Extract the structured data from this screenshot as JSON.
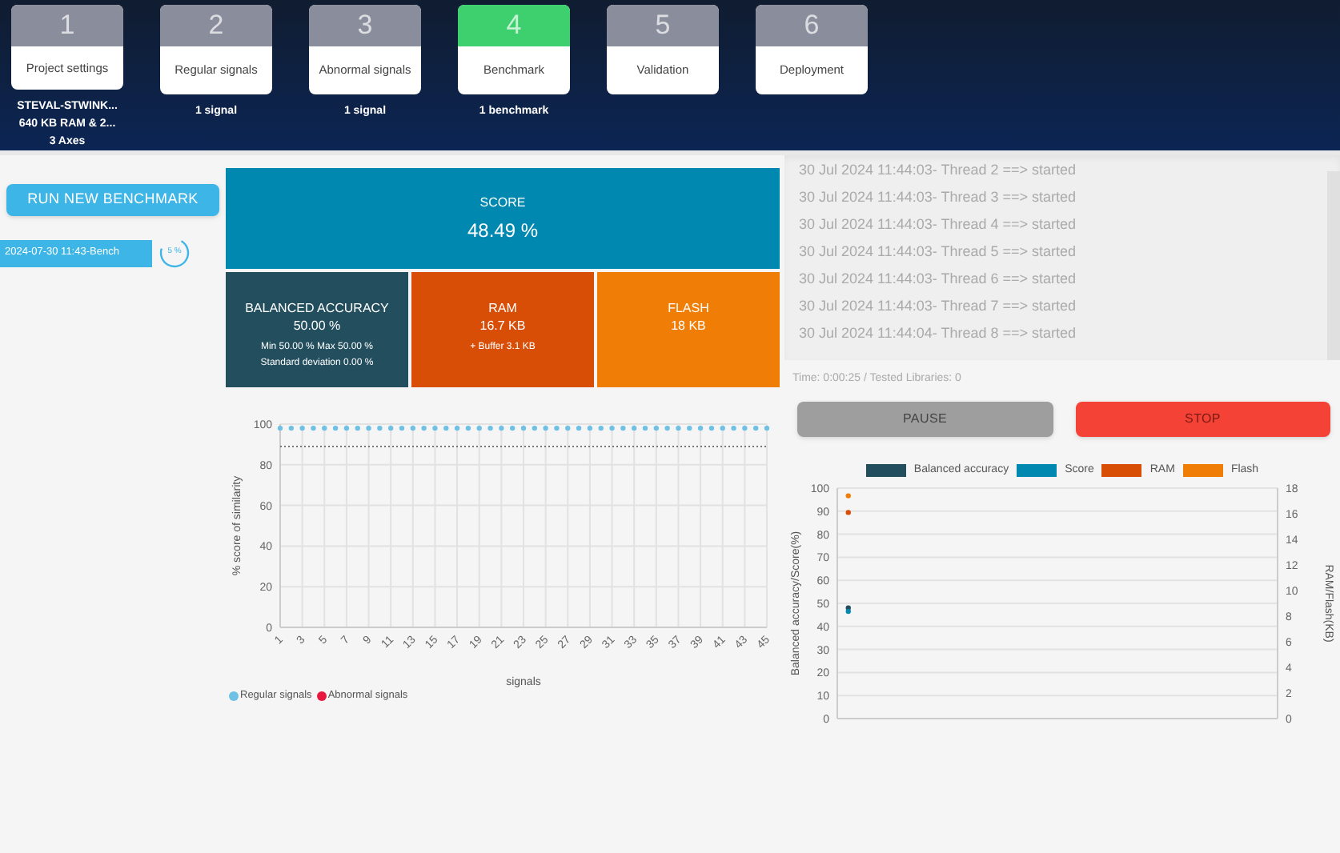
{
  "steps": [
    {
      "number": "1",
      "label": "Project settings",
      "selected": false,
      "captions": [
        "STEVAL-STWINK...",
        "640 KB RAM & 2...",
        "3 Axes"
      ]
    },
    {
      "number": "2",
      "label": "Regular signals",
      "selected": false,
      "captions": [
        "1 signal"
      ]
    },
    {
      "number": "3",
      "label": "Abnormal signals",
      "selected": false,
      "captions": [
        "1 signal"
      ]
    },
    {
      "number": "4",
      "label": "Benchmark",
      "selected": true,
      "captions": [
        "1 benchmark"
      ]
    },
    {
      "number": "5",
      "label": "Validation",
      "selected": false
    },
    {
      "number": "6",
      "label": "Deployment",
      "selected": false
    }
  ],
  "sidebar": {
    "run_button": "RUN NEW BENCHMARK",
    "benchmarks": [
      {
        "name": "2024-07-30 11:43-Bench",
        "progress": "5 %",
        "selected": true
      }
    ]
  },
  "score": {
    "title": "SCORE",
    "value": "48.49 %"
  },
  "metrics": [
    {
      "title": "BALANCED ACCURACY",
      "value": "50.00 %",
      "details": [
        "Min 50.00 % Max 50.00 %",
        "Standard deviation 0.00 %"
      ],
      "color": "#234e5e"
    },
    {
      "title": "RAM",
      "value": "16.7 KB",
      "details": [
        "+ Buffer 3.1 KB"
      ],
      "color": "#d94e06"
    },
    {
      "title": "FLASH",
      "value": "18 KB",
      "color": "#f07e06"
    }
  ],
  "log": {
    "lines": [
      "30 Jul 2024 11:44:03- Thread 2 ==> started",
      "30 Jul 2024 11:44:03- Thread 3 ==> started",
      "30 Jul 2024 11:44:03- Thread 4 ==> started",
      "30 Jul 2024 11:44:03- Thread 5 ==> started",
      "30 Jul 2024 11:44:03- Thread 6 ==> started",
      "30 Jul 2024 11:44:03- Thread 7 ==> started",
      "30 Jul 2024 11:44:04- Thread 8 ==> started"
    ],
    "status": "Time: 0:00:25 / Tested Libraries: 0"
  },
  "buttons": [
    {
      "kind": "pause",
      "label": "PAUSE"
    },
    {
      "kind": "stop",
      "label": "STOP"
    }
  ],
  "similarity_chart": {
    "chart_data": {
      "type": "scatter",
      "xlabel": "signals",
      "ylabel": "% score of similarity",
      "grid": true,
      "x": [
        1,
        2,
        3,
        4,
        5,
        6,
        7,
        8,
        9,
        10,
        11,
        12,
        13,
        14,
        15,
        16,
        17,
        18,
        19,
        20,
        21,
        22,
        23,
        24,
        25,
        26,
        27,
        28,
        29,
        30,
        31,
        32,
        33,
        34,
        35,
        36,
        37,
        38,
        39,
        40,
        41,
        42,
        43,
        44,
        45
      ],
      "xlim": [
        1,
        45
      ],
      "ylim": [
        0,
        100
      ],
      "xticks": [
        1,
        3,
        5,
        7,
        9,
        11,
        13,
        15,
        17,
        19,
        21,
        23,
        25,
        27,
        29,
        31,
        33,
        35,
        37,
        39,
        41,
        43,
        45
      ],
      "yticks": [
        0,
        20,
        40,
        60,
        80,
        100
      ],
      "series": [
        {
          "name": "Regular signals",
          "color": "#6ec1e4",
          "values": [
            98,
            98,
            98,
            98,
            98,
            98,
            98,
            98,
            98,
            98,
            98,
            98,
            98,
            98,
            98,
            98,
            98,
            98,
            98,
            98,
            98,
            98,
            98,
            98,
            98,
            98,
            98,
            98,
            98,
            98,
            98,
            98,
            98,
            98,
            98,
            98,
            98,
            98,
            98,
            98,
            98,
            98,
            98,
            98,
            98
          ]
        },
        {
          "name": "Abnormal signals",
          "color": "#e8173f",
          "values": [
            null,
            null,
            null,
            null,
            null,
            null,
            null,
            null,
            null,
            null,
            null,
            null,
            null,
            null,
            null,
            null,
            null,
            null,
            null,
            null,
            null,
            null,
            null,
            null,
            null,
            null,
            null,
            null,
            null,
            null,
            null,
            null,
            null,
            null,
            null,
            null,
            null,
            null,
            null,
            null,
            null,
            null,
            null,
            null,
            null
          ]
        }
      ],
      "ref_lines": [
        {
          "axis": "y",
          "value": 89
        }
      ]
    }
  },
  "history_chart": {
    "accuracy_axis": {
      "chart_data": {
        "type": "scatter",
        "ylabel": "Balanced accuracy/Score(%)",
        "grid": true,
        "categories": [
          null,
          null,
          null,
          null,
          null,
          null,
          null,
          null,
          null,
          null,
          null,
          null,
          null,
          null,
          null,
          null,
          null,
          null,
          null,
          null
        ],
        "ylim": [
          0,
          100
        ],
        "yticks": [
          0,
          10,
          20,
          30,
          40,
          50,
          60,
          70,
          80,
          90,
          100
        ],
        "series": [
          {
            "name": "Balanced accuracy",
            "color": "#234e5e",
            "values": [
              48,
              null,
              null,
              null,
              null,
              null,
              null,
              null,
              null,
              null,
              null,
              null,
              null,
              null,
              null,
              null,
              null,
              null,
              null,
              null
            ]
          },
          {
            "name": "Score",
            "color": "#0088b0",
            "values": [
              46.5,
              null,
              null,
              null,
              null,
              null,
              null,
              null,
              null,
              null,
              null,
              null,
              null,
              null,
              null,
              null,
              null,
              null,
              null,
              null
            ]
          }
        ]
      }
    },
    "memory_axis": {
      "chart_data": {
        "type": "scatter",
        "ylabel": "RAM/Flash(KB)",
        "categories": [
          null,
          null,
          null,
          null,
          null,
          null,
          null,
          null,
          null,
          null,
          null,
          null,
          null,
          null,
          null,
          null,
          null,
          null,
          null,
          null
        ],
        "ylim": [
          0,
          18
        ],
        "yticks": [
          0,
          2,
          4,
          6,
          8,
          10,
          12,
          14,
          16,
          18
        ],
        "series": [
          {
            "name": "RAM",
            "color": "#d94e06",
            "values": [
              16.1,
              null,
              null,
              null,
              null,
              null,
              null,
              null,
              null,
              null,
              null,
              null,
              null,
              null,
              null,
              null,
              null,
              null,
              null,
              null
            ]
          },
          {
            "name": "Flash",
            "color": "#f07e06",
            "values": [
              17.4,
              null,
              null,
              null,
              null,
              null,
              null,
              null,
              null,
              null,
              null,
              null,
              null,
              null,
              null,
              null,
              null,
              null,
              null,
              null
            ]
          }
        ]
      }
    }
  }
}
